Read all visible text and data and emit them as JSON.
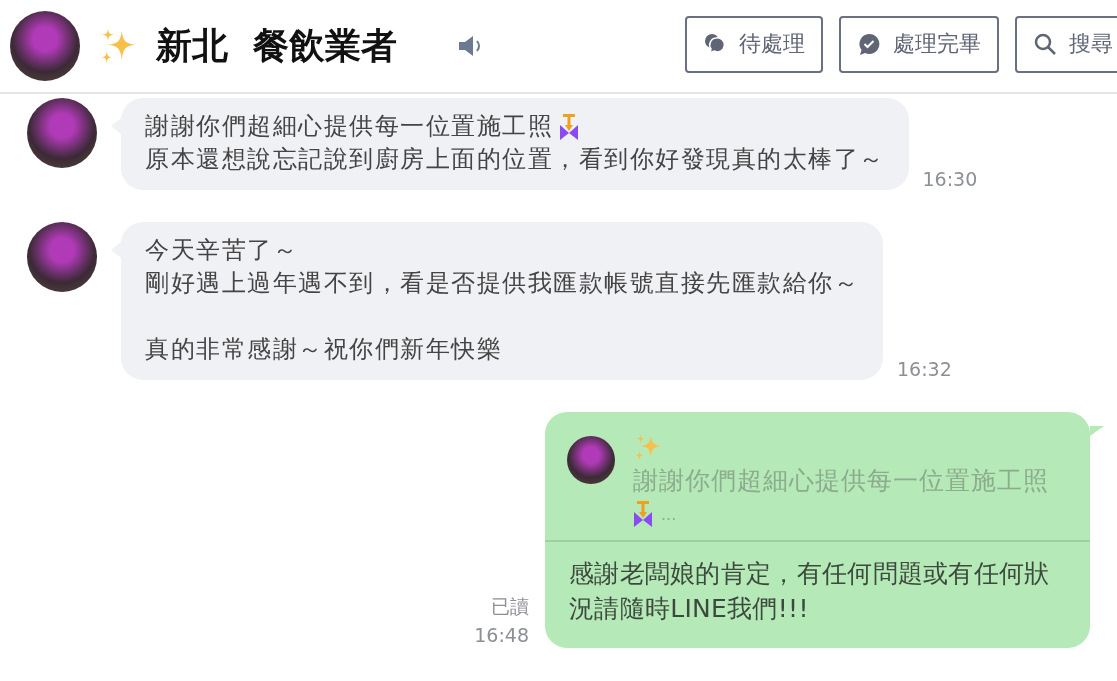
{
  "header": {
    "title": "新北  餐飲業者",
    "buttons": [
      {
        "label": "待處理",
        "kind": "pending"
      },
      {
        "label": "處理完畢",
        "kind": "done"
      },
      {
        "label": "搜尋",
        "kind": "search"
      }
    ]
  },
  "messages": [
    {
      "kind": "incoming",
      "medal": true,
      "paragraphs": [
        [
          "謝謝你們超細心提供每一位置施工照",
          "原本還想說忘記說到廚房上面的位置，看到你好發現真的太棒了～"
        ]
      ],
      "time": "16:30"
    },
    {
      "kind": "incoming",
      "paragraphs": [
        [
          "今天辛苦了～",
          "剛好遇上過年遇不到，看是否提供我匯款帳號直接先匯款給你～"
        ],
        [
          "真的非常感謝～祝你們新年快樂"
        ]
      ],
      "time": "16:32"
    },
    {
      "kind": "outgoing",
      "reply": {
        "text": "謝謝你們超細心提供每一位置施工照",
        "ellipsis": "..."
      },
      "text": "感謝老闆娘的肯定，有任何問題或有任何狀況請隨時LINE我們!!!",
      "read": "已讀",
      "time": "16:48"
    }
  ]
}
